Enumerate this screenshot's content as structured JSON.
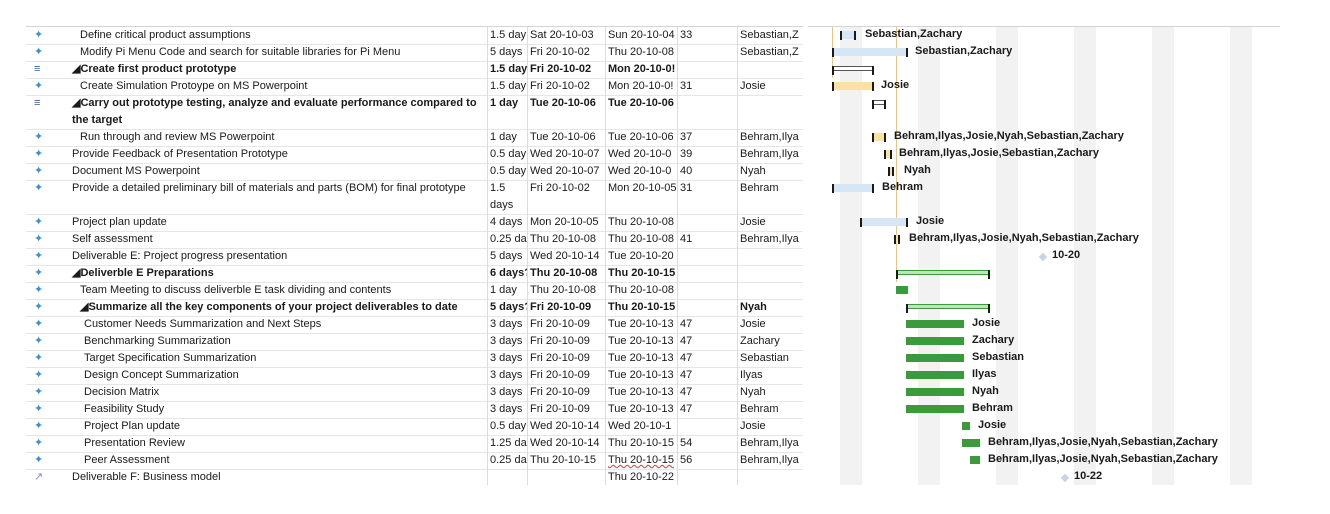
{
  "colors": {
    "accent": "#3b9a3b",
    "bar_light": "#d6e6f5",
    "bar_yellow": "#fbe2a0",
    "weekend_shade": "#f2f2f2"
  },
  "rows": [
    {
      "icon": "task-pin-icon",
      "name": "Define critical product assumptions",
      "indent": 1,
      "bold": false,
      "duration": "1.5 day",
      "start": "Sat 20-10-03",
      "finish": "Sun 20-10-04",
      "predecessors": "33",
      "resources": "Sebastian,Z",
      "bar_label": "Sebastian,Zachary"
    },
    {
      "icon": "task-pin-icon",
      "name": "Modify Pi Menu Code and search for suitable libraries for Pi Menu",
      "indent": 1,
      "bold": false,
      "duration": "5 days",
      "start": "Fri 20-10-02",
      "finish": "Thu 20-10-08",
      "predecessors": "",
      "resources": "Sebastian,Z",
      "bar_label": "Sebastian,Zachary"
    },
    {
      "icon": "summary-icon",
      "name": "◢Create first product prototype",
      "indent": 0,
      "bold": true,
      "duration": "1.5 day",
      "start": "Fri 20-10-02",
      "finish": "Mon 20-10-0!",
      "predecessors": "",
      "resources": "",
      "bar_label": ""
    },
    {
      "icon": "task-pin-icon",
      "name": "Create Simulation Protoype on MS Powerpoint",
      "indent": 1,
      "bold": false,
      "duration": "1.5 day",
      "start": "Fri 20-10-02",
      "finish": "Mon 20-10-0!",
      "predecessors": "31",
      "resources": "Josie",
      "bar_label": "Josie"
    },
    {
      "icon": "summary-icon",
      "name": "◢Carry out prototype testing, analyze and evaluate performance compared to the target",
      "indent": 0,
      "bold": true,
      "duration": "1 day",
      "start": "Tue 20-10-06",
      "finish": "Tue 20-10-06",
      "predecessors": "",
      "resources": "",
      "bar_label": ""
    },
    {
      "icon": "task-pin-icon",
      "name": "Run through and review MS Powerpoint",
      "indent": 1,
      "bold": false,
      "duration": "1 day",
      "start": "Tue 20-10-06",
      "finish": "Tue 20-10-06",
      "predecessors": "37",
      "resources": "Behram,Ilya",
      "bar_label": "Behram,Ilyas,Josie,Nyah,Sebastian,Zachary"
    },
    {
      "icon": "task-pin-icon",
      "name": "Provide Feedback of Presentation Prototype",
      "indent": 0,
      "bold": false,
      "duration": "0.5 day",
      "start": "Wed 20-10-07",
      "finish": "Wed 20-10-0",
      "predecessors": "39",
      "resources": "Behram,Ilya",
      "bar_label": "Behram,Ilyas,Josie,Sebastian,Zachary"
    },
    {
      "icon": "task-pin-icon",
      "name": "Document MS Powerpoint",
      "indent": 0,
      "bold": false,
      "duration": "0.5 day",
      "start": "Wed 20-10-07",
      "finish": "Wed 20-10-0",
      "predecessors": "40",
      "resources": "Nyah",
      "bar_label": "Nyah"
    },
    {
      "icon": "task-pin-icon",
      "name": "Provide a detailed preliminary bill of materials and parts (BOM) for final prototype",
      "indent": 0,
      "bold": false,
      "duration": "1.5 days",
      "start": "Fri 20-10-02",
      "finish": "Mon 20-10-05",
      "predecessors": "31",
      "resources": "Behram",
      "bar_label": "Behram"
    },
    {
      "icon": "task-pin-icon",
      "name": "Project plan update",
      "indent": 0,
      "bold": false,
      "duration": "4 days",
      "start": "Mon 20-10-05",
      "finish": "Thu 20-10-08",
      "predecessors": "",
      "resources": "Josie",
      "bar_label": "Josie"
    },
    {
      "icon": "task-pin-icon",
      "name": "Self assessment",
      "indent": 0,
      "bold": false,
      "duration": "0.25 da",
      "start": "Thu 20-10-08",
      "finish": "Thu 20-10-08",
      "predecessors": "41",
      "resources": "Behram,Ilya",
      "bar_label": "Behram,Ilyas,Josie,Nyah,Sebastian,Zachary"
    },
    {
      "icon": "task-pin-icon",
      "name": "Deliverable E: Project progress presentation",
      "indent": 0,
      "bold": false,
      "duration": "5 days",
      "start": "Wed 20-10-14",
      "finish": "Tue 20-10-20",
      "predecessors": "",
      "resources": "",
      "bar_label": "10-20"
    },
    {
      "icon": "task-pin-icon",
      "name": "◢Deliverble E Preparations",
      "indent": 0,
      "bold": true,
      "duration": "6 days?",
      "start": "Thu 20-10-08",
      "finish": "Thu 20-10-15",
      "predecessors": "",
      "resources": "",
      "bar_label": ""
    },
    {
      "icon": "task-pin-icon",
      "name": "Team Meeting to discuss deliverble E task dividing and contents",
      "indent": 1,
      "bold": false,
      "duration": "1 day",
      "start": "Thu 20-10-08",
      "finish": "Thu 20-10-08",
      "predecessors": "",
      "resources": "",
      "bar_label": ""
    },
    {
      "icon": "task-pin-icon",
      "name": "◢Summarize all the key components of your project deliverables to date",
      "indent": 1,
      "bold": true,
      "duration": "5 days?",
      "start": "Fri 20-10-09",
      "finish": "Thu 20-10-15",
      "predecessors": "",
      "resources": "Nyah",
      "bar_label": ""
    },
    {
      "icon": "task-pin-icon",
      "name": "Customer Needs Summarization and Next Steps",
      "indent": 2,
      "bold": false,
      "duration": "3 days",
      "start": "Fri 20-10-09",
      "finish": "Tue 20-10-13",
      "predecessors": "47",
      "resources": "Josie",
      "bar_label": "Josie"
    },
    {
      "icon": "task-pin-icon",
      "name": "Benchmarking Summarization",
      "indent": 2,
      "bold": false,
      "duration": "3 days",
      "start": "Fri 20-10-09",
      "finish": "Tue 20-10-13",
      "predecessors": "47",
      "resources": "Zachary",
      "bar_label": "Zachary"
    },
    {
      "icon": "task-pin-icon",
      "name": "Target Specification Summarization",
      "indent": 2,
      "bold": false,
      "duration": "3 days",
      "start": "Fri 20-10-09",
      "finish": "Tue 20-10-13",
      "predecessors": "47",
      "resources": "Sebastian",
      "bar_label": "Sebastian"
    },
    {
      "icon": "task-pin-icon",
      "name": "Design Concept Summarization",
      "indent": 2,
      "bold": false,
      "duration": "3 days",
      "start": "Fri 20-10-09",
      "finish": "Tue 20-10-13",
      "predecessors": "47",
      "resources": "Ilyas",
      "bar_label": "Ilyas"
    },
    {
      "icon": "task-pin-icon",
      "name": "Decision Matrix",
      "indent": 2,
      "bold": false,
      "duration": "3 days",
      "start": "Fri 20-10-09",
      "finish": "Tue 20-10-13",
      "predecessors": "47",
      "resources": "Nyah",
      "bar_label": "Nyah"
    },
    {
      "icon": "task-pin-icon",
      "name": "Feasibility Study",
      "indent": 2,
      "bold": false,
      "duration": "3 days",
      "start": "Fri 20-10-09",
      "finish": "Tue 20-10-13",
      "predecessors": "47",
      "resources": "Behram",
      "bar_label": "Behram"
    },
    {
      "icon": "task-pin-icon",
      "name": "Project Plan update",
      "indent": 2,
      "bold": false,
      "duration": "0.5 day",
      "start": "Wed 20-10-14",
      "finish": "Wed 20-10-1",
      "predecessors": "",
      "resources": "Josie",
      "bar_label": "Josie"
    },
    {
      "icon": "task-pin-icon",
      "name": "Presentation Review",
      "indent": 2,
      "bold": false,
      "duration": "1.25 da",
      "start": "Wed 20-10-14",
      "finish": "Thu 20-10-15",
      "predecessors": "54",
      "resources": "Behram,Ilya",
      "bar_label": "Behram,Ilyas,Josie,Nyah,Sebastian,Zachary"
    },
    {
      "icon": "task-pin-icon",
      "name": "Peer Assessment",
      "indent": 2,
      "bold": false,
      "duration": "0.25 da",
      "start": "Thu 20-10-15",
      "finish": "Thu 20-10-15",
      "predecessors": "56",
      "resources": "Behram,Ilya",
      "bar_label": "Behram,Ilyas,Josie,Nyah,Sebastian,Zachary"
    },
    {
      "icon": "task-manual-icon",
      "name": "Deliverable F: Business model",
      "indent": 0,
      "bold": false,
      "duration": "",
      "start": "",
      "finish": "Thu 20-10-22",
      "predecessors": "",
      "resources": "",
      "bar_label": "10-22"
    }
  ]
}
